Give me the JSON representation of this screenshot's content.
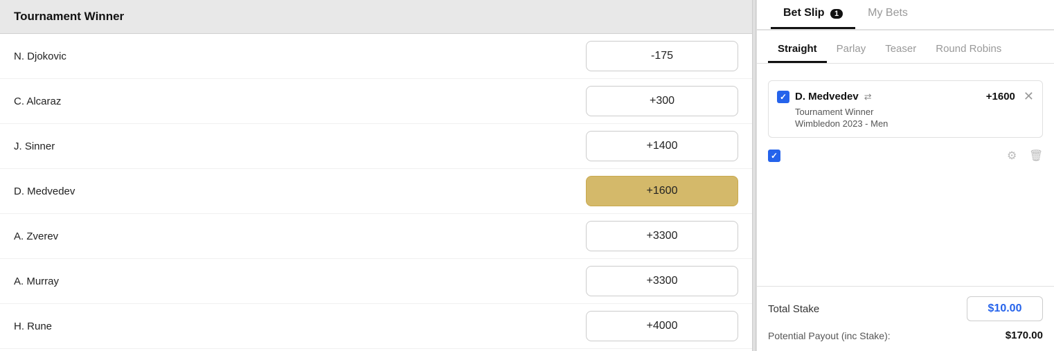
{
  "left": {
    "title": "Tournament Winner",
    "players": [
      {
        "name": "N. Djokovic",
        "odds": "-175",
        "selected": false
      },
      {
        "name": "C. Alcaraz",
        "odds": "+300",
        "selected": false
      },
      {
        "name": "J. Sinner",
        "odds": "+1400",
        "selected": false
      },
      {
        "name": "D. Medvedev",
        "odds": "+1600",
        "selected": true
      },
      {
        "name": "A. Zverev",
        "odds": "+3300",
        "selected": false
      },
      {
        "name": "A. Murray",
        "odds": "+3300",
        "selected": false
      },
      {
        "name": "H. Rune",
        "odds": "+4000",
        "selected": false
      }
    ]
  },
  "right": {
    "header_tabs": [
      {
        "id": "bet-slip",
        "label": "Bet Slip",
        "badge": "1",
        "active": true
      },
      {
        "id": "my-bets",
        "label": "My Bets",
        "badge": null,
        "active": false
      }
    ],
    "bet_tabs": [
      {
        "id": "straight",
        "label": "Straight",
        "active": true
      },
      {
        "id": "parlay",
        "label": "Parlay",
        "active": false
      },
      {
        "id": "teaser",
        "label": "Teaser",
        "active": false
      },
      {
        "id": "round-robins",
        "label": "Round Robins",
        "active": false
      }
    ],
    "bet_entry": {
      "player": "D. Medvedev",
      "odds": "+1600",
      "subtitle1": "Tournament Winner",
      "subtitle2": "Wimbledon 2023 - Men"
    },
    "total_stake_label": "Total Stake",
    "total_stake_value": "$10.00",
    "payout_label": "Potential Payout (inc Stake):",
    "payout_value": "$170.00"
  }
}
